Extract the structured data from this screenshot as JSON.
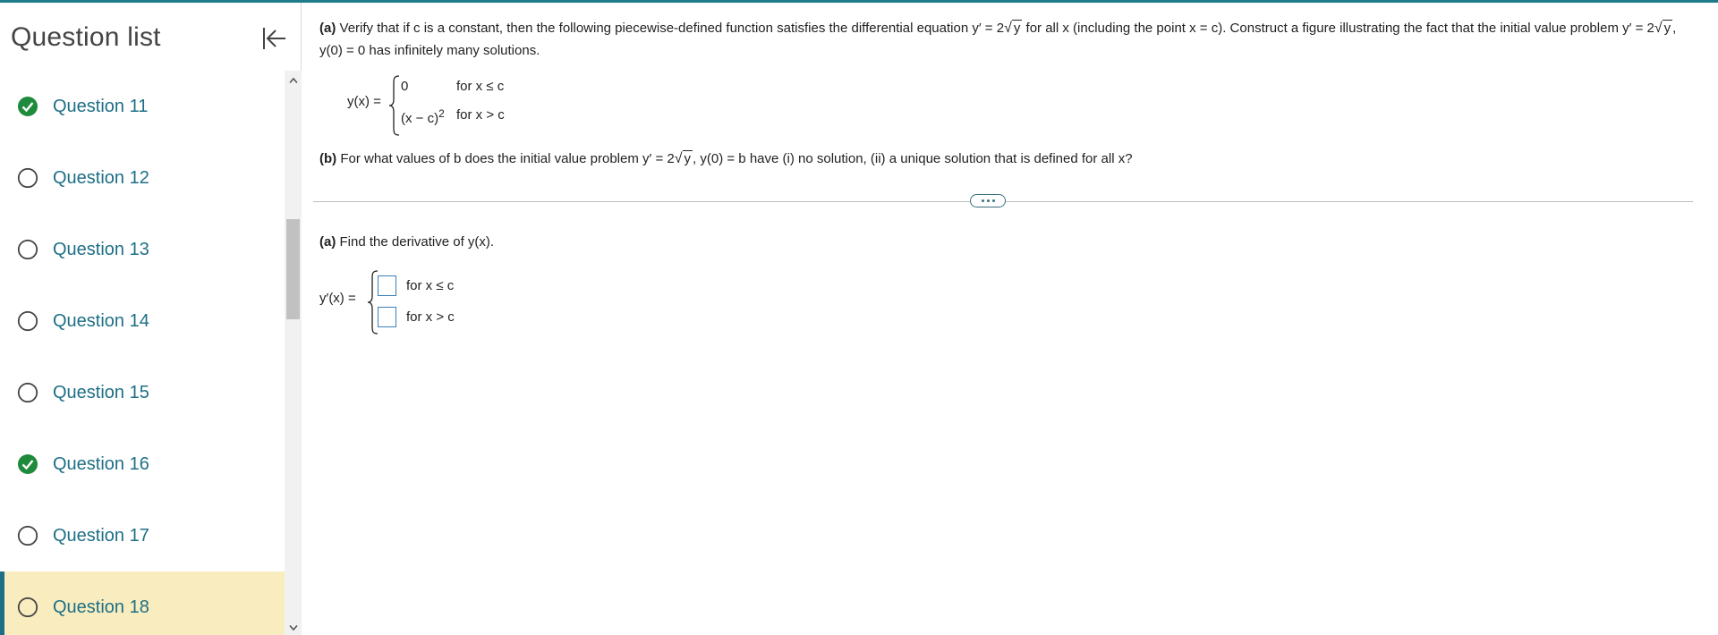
{
  "sidebar": {
    "title": "Question list",
    "collapse_icon": "collapse-left-icon",
    "questions": [
      {
        "label": "Question 11",
        "status": "complete"
      },
      {
        "label": "Question 12",
        "status": "incomplete"
      },
      {
        "label": "Question 13",
        "status": "incomplete"
      },
      {
        "label": "Question 14",
        "status": "incomplete"
      },
      {
        "label": "Question 15",
        "status": "incomplete"
      },
      {
        "label": "Question 16",
        "status": "complete"
      },
      {
        "label": "Question 17",
        "status": "incomplete"
      },
      {
        "label": "Question 18",
        "status": "incomplete",
        "active": true
      }
    ]
  },
  "question": {
    "part_a": {
      "marker": "(a)",
      "text_1": "Verify that if c is a constant, then the following piecewise-defined function satisfies the differential equation y′ = 2",
      "text_2": "for all x (including the point x = c). Construct a figure illustrating the fact that the initial value problem y′ = 2",
      "text_3": ", y(0) = 0 has infinitely many solutions.",
      "radicand": "y",
      "function_label": "y(x) =",
      "cases": [
        {
          "expr": "0",
          "condition": "for x ≤ c"
        },
        {
          "expr": "(x − c)",
          "exponent": "2",
          "condition": "for x > c"
        }
      ]
    },
    "part_b": {
      "marker": "(b)",
      "text_1": "For what values of b does the initial value problem y′ = 2",
      "text_2": ", y(0) = b have (i) no solution, (ii) a unique solution that is defined for all x?",
      "radicand": "y"
    }
  },
  "answer": {
    "marker": "(a)",
    "prompt": "Find the derivative of y(x).",
    "label": "y′(x) =",
    "cases": [
      {
        "condition": "for x ≤ c",
        "value": ""
      },
      {
        "condition": "for x > c",
        "value": ""
      }
    ]
  },
  "colors": {
    "accent": "#1d6f86",
    "complete_green": "#1e8a3c",
    "active_row_bg": "#f9edbf",
    "input_border": "#3c7fb8"
  }
}
